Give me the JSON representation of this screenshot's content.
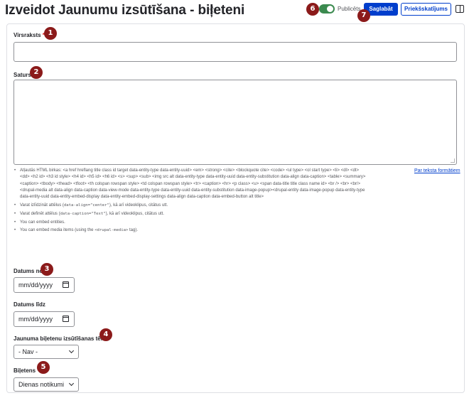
{
  "header": {
    "title": "Izveidot Jaunumu izsūtīšana - biļeteni",
    "star_glyph": "☆",
    "published_label": "Publicēts",
    "published_on": true,
    "save_label": "Saglabāt",
    "preview_label": "Priekšskatījums"
  },
  "form": {
    "title_field": {
      "label": "Virsraksts",
      "required_mark": "*",
      "value": ""
    },
    "body_field": {
      "label": "Saturs",
      "value": ""
    },
    "help": {
      "items": [
        "Atļautās HTML birkas: <a href hreflang title class id target data-entity-type data-entity-uuid> <em> <strong> <cite> <blockquote cite> <code> <ul type> <ol start type> <li> <dl> <dt> <dd> <h2 id> <h3 id style> <h4 id> <h5 id> <h6 id> <s> <sup> <sub> <img src alt data-entity-type data-entity-uuid data-entity-substitution data-align data-caption> <table> <summary> <caption> <tbody> <thead> <tfoot> <th colspan rowspan style> <td colspan rowspan style> <tr> <caption> <hr> <p class> <u> <span data-title title class name id> <br /> <br> <br/> <drupal-media alt data-align data-caption data-view-mode data-entity-type data-entity-uuid data-entity-substitution data-image-popup><drupal-entity data-image-popup data-entity-type data-entity-uuid data-entity-embed-display data-entity-embed-display-settings data-align data-caption data-embed-button alt title>"
      ],
      "align_pre": "Varat izlīdzināt attēlus (",
      "align_code": "data-align=\"center\"",
      "align_post": "), kā arī videoklipus, citātus utt.",
      "caption_pre": "Varat definēt attēlus (",
      "caption_code": "data-caption=\"Text\"",
      "caption_post": "), kā arī videoklipus, citātus utt.",
      "embed_entities": "You can embed entities.",
      "embed_media_pre": "You can embed media items (using the ",
      "embed_media_code": "<drupal-media>",
      "embed_media_post": " tag).",
      "format_link": "Par teksta formātiem"
    },
    "date_from": {
      "label": "Datums no",
      "placeholder": "mm/dd/yyyy"
    },
    "date_to": {
      "label": "Datums līdz",
      "placeholder": "mm/dd/yyyy"
    },
    "topic": {
      "label": "Jaunuma biļetenu izsūtīšanas tēma",
      "selected": "- Nav -"
    },
    "newsletter": {
      "label": "Biļetens",
      "required_mark": "*",
      "selected": "Dienas notikumi"
    }
  },
  "markers": [
    "1",
    "2",
    "3",
    "4",
    "5",
    "6",
    "7"
  ],
  "colors": {
    "accent": "#003ecc",
    "toggle_on": "#3b8a4f",
    "marker": "#8b1a1a",
    "required": "#dc2323"
  }
}
